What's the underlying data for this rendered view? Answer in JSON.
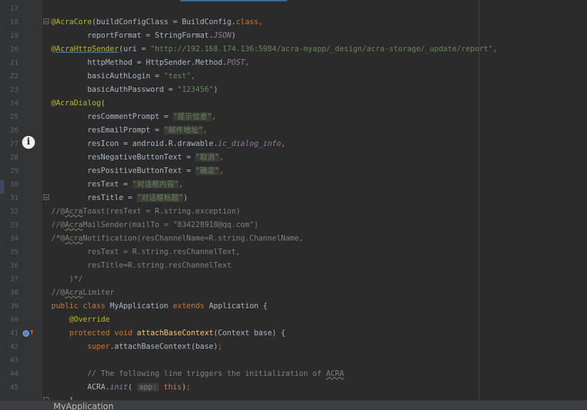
{
  "editor": {
    "lines": [
      {
        "n": "17",
        "tokens": []
      },
      {
        "n": "18",
        "tokens": [
          {
            "c": "ann",
            "t": "@AcraCore"
          },
          {
            "t": "(buildConfigClass = BuildConfig."
          },
          {
            "c": "kw",
            "t": "class"
          },
          {
            "c": "kw",
            "t": ","
          }
        ]
      },
      {
        "n": "19",
        "tokens": [
          {
            "t": "        reportFormat = StringFormat."
          },
          {
            "c": "it",
            "t": "JSON"
          },
          {
            "t": ")"
          }
        ]
      },
      {
        "n": "20",
        "tokens": [
          {
            "c": "ann",
            "t": "@"
          },
          {
            "c": "ann ul",
            "t": "AcraHttpSender"
          },
          {
            "t": "(uri = "
          },
          {
            "c": "str",
            "t": "\"http://192.168.174.136:5984/acra-myapp/_design/acra-storage/_update/report\""
          },
          {
            "c": "kw",
            "t": ","
          }
        ]
      },
      {
        "n": "21",
        "tokens": [
          {
            "t": "        httpMethod = HttpSender.Method."
          },
          {
            "c": "it",
            "t": "POST"
          },
          {
            "c": "kw",
            "t": ","
          }
        ]
      },
      {
        "n": "22",
        "tokens": [
          {
            "t": "        basicAuthLogin = "
          },
          {
            "c": "str",
            "t": "\"test\""
          },
          {
            "c": "kw",
            "t": ","
          }
        ]
      },
      {
        "n": "23",
        "tokens": [
          {
            "t": "        basicAuthPassword = "
          },
          {
            "c": "str",
            "t": "\"123456\""
          },
          {
            "t": ")"
          }
        ]
      },
      {
        "n": "24",
        "tokens": [
          {
            "c": "ann",
            "t": "@AcraDialog"
          },
          {
            "t": "("
          }
        ]
      },
      {
        "n": "25",
        "tokens": [
          {
            "t": "        resCommentPrompt = "
          },
          {
            "c": "str-cn",
            "t": "\"提示信息\""
          },
          {
            "c": "kw",
            "t": ","
          }
        ]
      },
      {
        "n": "26",
        "tokens": [
          {
            "t": "        resEmailPrompt = "
          },
          {
            "c": "str-cn",
            "t": "\"邮件地址\""
          },
          {
            "c": "kw",
            "t": ","
          }
        ]
      },
      {
        "n": "27",
        "tokens": [
          {
            "t": "        resIcon = android.R.drawable."
          },
          {
            "c": "it",
            "t": "ic_dialog_info"
          },
          {
            "c": "kw",
            "t": ","
          }
        ]
      },
      {
        "n": "28",
        "tokens": [
          {
            "t": "        resNegativeButtonText = "
          },
          {
            "c": "str-cn",
            "t": "\"取消\""
          },
          {
            "c": "kw",
            "t": ","
          }
        ]
      },
      {
        "n": "29",
        "tokens": [
          {
            "t": "        resPositiveButtonText = "
          },
          {
            "c": "str-cn",
            "t": "\"确定\""
          },
          {
            "c": "kw",
            "t": ","
          }
        ]
      },
      {
        "n": "30",
        "tokens": [
          {
            "t": "        resText = "
          },
          {
            "c": "str-cn",
            "t": "\"对话框内容\""
          },
          {
            "c": "kw",
            "t": ","
          }
        ]
      },
      {
        "n": "31",
        "tokens": [
          {
            "t": "        resTitle = "
          },
          {
            "c": "str-cn",
            "t": "\"对话框标题\""
          },
          {
            "t": ")"
          }
        ]
      },
      {
        "n": "32",
        "tokens": [
          {
            "c": "cmt",
            "t": "//@"
          },
          {
            "c": "cmt wavy",
            "t": "Acra"
          },
          {
            "c": "cmt",
            "t": "Toast(resText = R.string.exception)"
          }
        ]
      },
      {
        "n": "33",
        "tokens": [
          {
            "c": "cmt",
            "t": "//@"
          },
          {
            "c": "cmt wavy",
            "t": "Acra"
          },
          {
            "c": "cmt",
            "t": "MailSender(mailTo = \"834228918@qq.com\")"
          }
        ]
      },
      {
        "n": "34",
        "tokens": [
          {
            "c": "cmt",
            "t": "/*@"
          },
          {
            "c": "cmt wavy",
            "t": "Acra"
          },
          {
            "c": "cmt",
            "t": "Notification(resChannelName=R.string.ChannelName,"
          }
        ]
      },
      {
        "n": "35",
        "tokens": [
          {
            "c": "cmt",
            "t": "        resText = R.string.resChannelText,"
          }
        ]
      },
      {
        "n": "36",
        "tokens": [
          {
            "c": "cmt",
            "t": "        resTitle=R.string.resChannelText"
          }
        ]
      },
      {
        "n": "37",
        "tokens": [
          {
            "c": "cmt",
            "t": "    )*/"
          }
        ]
      },
      {
        "n": "38",
        "tokens": [
          {
            "c": "cmt",
            "t": "//@"
          },
          {
            "c": "cmt wavy",
            "t": "Acra"
          },
          {
            "c": "cmt",
            "t": "Limiter"
          }
        ]
      },
      {
        "n": "39",
        "tokens": [
          {
            "c": "kw",
            "t": "public class "
          },
          {
            "t": "MyApplication "
          },
          {
            "c": "kw",
            "t": "extends "
          },
          {
            "t": "Application {"
          }
        ]
      },
      {
        "n": "40",
        "tokens": [
          {
            "t": "    "
          },
          {
            "c": "ann",
            "t": "@Override"
          }
        ]
      },
      {
        "n": "41",
        "tokens": [
          {
            "t": "    "
          },
          {
            "c": "kw",
            "t": "protected void "
          },
          {
            "c": "met",
            "t": "attachBaseContext"
          },
          {
            "t": "(Context base) {"
          }
        ]
      },
      {
        "n": "42",
        "tokens": [
          {
            "t": "        "
          },
          {
            "c": "kw",
            "t": "super"
          },
          {
            "t": ".attachBaseContext(base)"
          },
          {
            "c": "kw",
            "t": ";"
          }
        ]
      },
      {
        "n": "43",
        "tokens": []
      },
      {
        "n": "44",
        "tokens": [
          {
            "c": "cmt",
            "t": "        // The following line triggers the initialization of "
          },
          {
            "c": "cmt wavy",
            "t": "ACRA"
          }
        ]
      },
      {
        "n": "45",
        "tokens": [
          {
            "t": "        ACRA."
          },
          {
            "c": "it",
            "t": "init"
          },
          {
            "t": "( "
          },
          {
            "c": "hint",
            "t": "app:"
          },
          {
            "t": " "
          },
          {
            "c": "kw",
            "t": "this"
          },
          {
            "t": ")"
          },
          {
            "c": "kw",
            "t": ";"
          }
        ]
      },
      {
        "n": "",
        "tokens": [
          {
            "t": "    }"
          }
        ]
      }
    ]
  },
  "status": {
    "breadcrumb": "MyApplication"
  },
  "icons": {
    "line27": "info-icon",
    "line41": "override-method-icon"
  }
}
